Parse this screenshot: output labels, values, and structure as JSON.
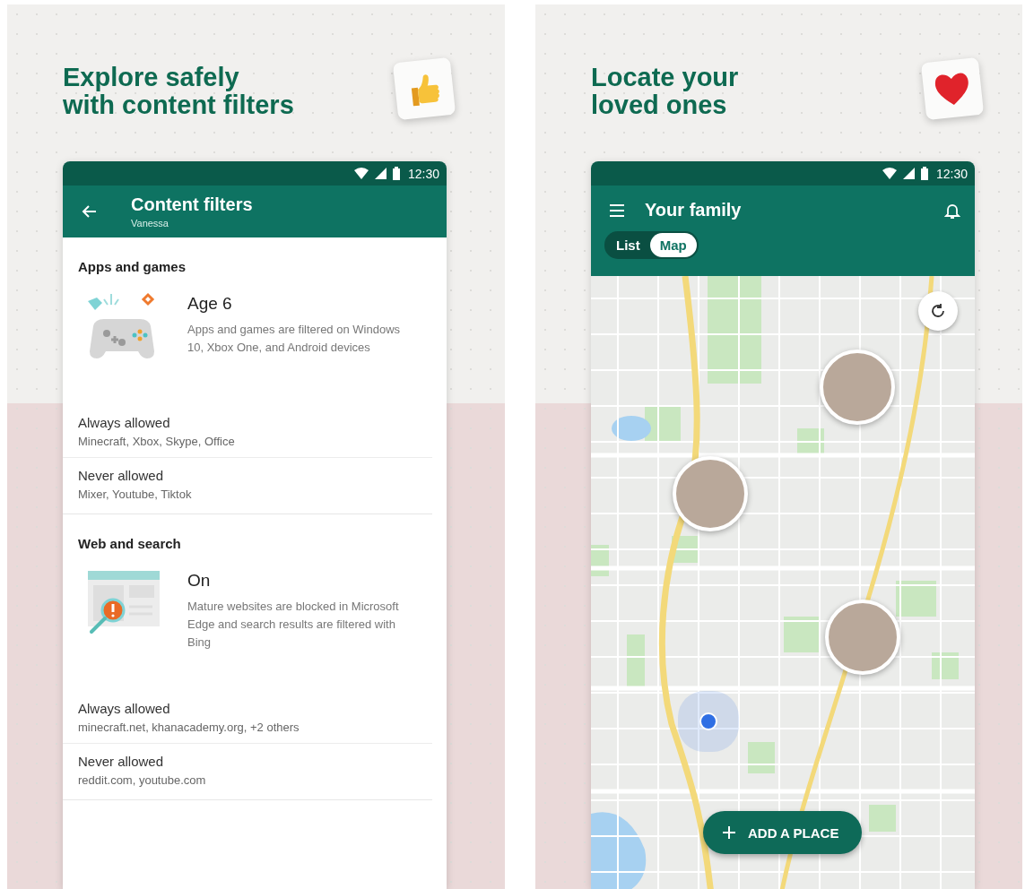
{
  "left_panel": {
    "headline": [
      "Explore safely",
      "with content filters"
    ],
    "status_bar": {
      "time": "12:30"
    },
    "app_bar": {
      "title": "Content filters",
      "subtitle": "Vanessa"
    },
    "sections": [
      {
        "kind": "games",
        "heading": "Apps and games",
        "summary_title": "Age 6",
        "summary_text": "Apps and games are filtered on Windows 10, Xbox One, and Android devices",
        "rules": [
          {
            "label": "Always allowed",
            "value": "Minecraft, Xbox, Skype, Office"
          },
          {
            "label": "Never allowed",
            "value": "Mixer, Youtube, Tiktok"
          }
        ]
      },
      {
        "kind": "web",
        "heading": "Web and search",
        "summary_title": "On",
        "summary_text": "Mature websites are blocked in Microsoft Edge and search results are filtered with Bing",
        "rules": [
          {
            "label": "Always allowed",
            "value": "minecraft.net, khanacademy.org, +2 others"
          },
          {
            "label": "Never allowed",
            "value": "reddit.com, youtube.com"
          }
        ]
      }
    ]
  },
  "right_panel": {
    "headline": [
      "Locate your",
      "loved ones"
    ],
    "status_bar": {
      "time": "12:30"
    },
    "app_bar": {
      "title": "Your family"
    },
    "view_toggle": [
      {
        "label": "List",
        "selected": false
      },
      {
        "label": "Map",
        "selected": true
      }
    ],
    "fab": {
      "label": "ADD A PLACE"
    }
  }
}
